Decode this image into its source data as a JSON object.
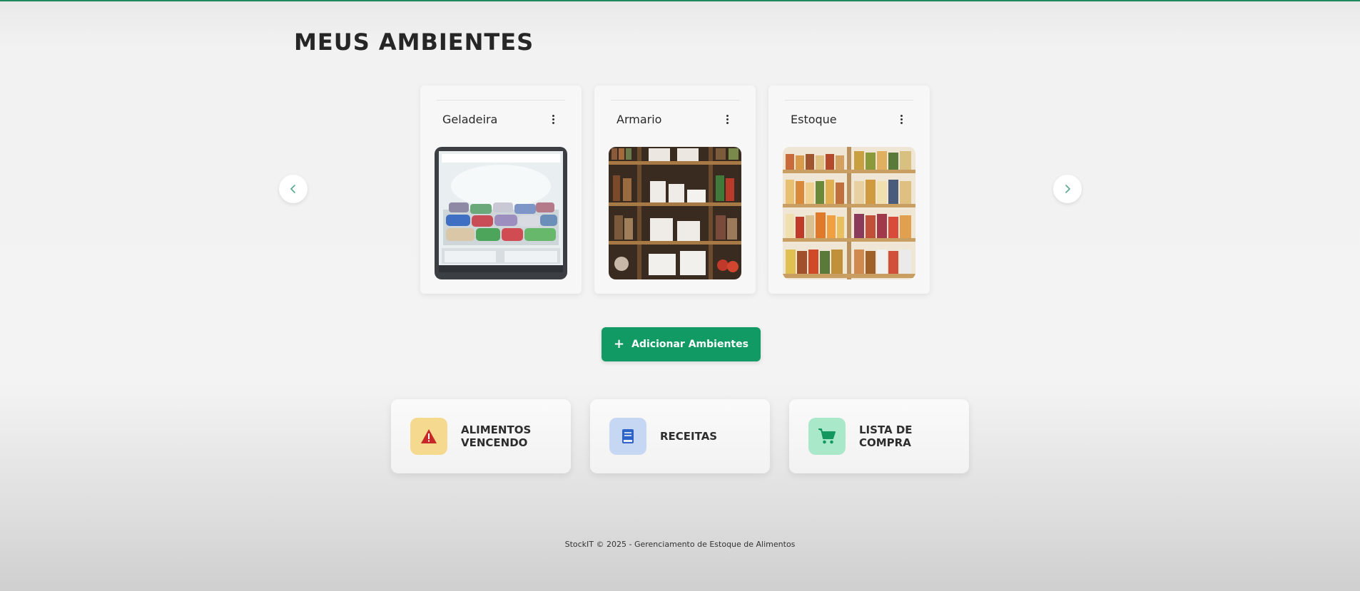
{
  "page": {
    "title": "MEUS AMBIENTES"
  },
  "environments": [
    {
      "name": "Geladeira",
      "image": "freezer-photo"
    },
    {
      "name": "Armario",
      "image": "pantry-shelves-photo"
    },
    {
      "name": "Estoque",
      "image": "jar-shelves-photo"
    }
  ],
  "carousel": {
    "prev_icon": "chevron-left-icon",
    "next_icon": "chevron-right-icon"
  },
  "add_button": {
    "icon": "plus-icon",
    "label": "Adicionar Ambientes"
  },
  "shortcuts": [
    {
      "label_line1": "ALIMENTOS",
      "label_line2": "VENCENDO",
      "icon": "warning-icon",
      "color": "#f5d98e"
    },
    {
      "label_line1": "RECEITAS",
      "label_line2": "",
      "icon": "book-icon",
      "color": "#c5d7f3"
    },
    {
      "label_line1": "LISTA DE",
      "label_line2": "COMPRA",
      "icon": "cart-icon",
      "color": "#a9e8c8"
    }
  ],
  "colors": {
    "accent": "#119a63",
    "warning": "#c62828",
    "book": "#2f62c7",
    "cart": "#14985f"
  },
  "footer": {
    "text": "StockIT © 2025 - Gerenciamento de Estoque de Alimentos"
  }
}
